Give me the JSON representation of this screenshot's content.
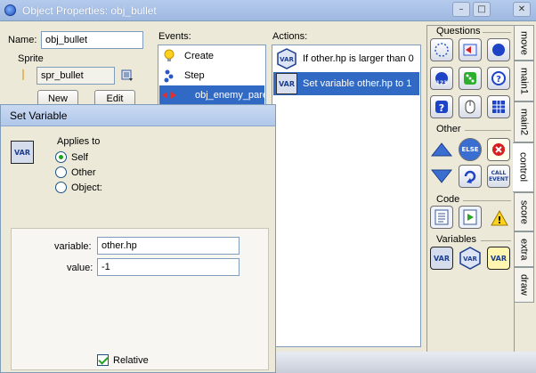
{
  "window": {
    "title": "Object Properties: obj_bullet",
    "minimize_label": "–",
    "maximize_label": "□",
    "close_label": "✕"
  },
  "object": {
    "name_label": "Name:",
    "name_value": "obj_bullet",
    "sprite_label": "Sprite",
    "sprite_value": "spr_bullet",
    "new_label": "New",
    "edit_label": "Edit"
  },
  "events": {
    "header": "Events:",
    "items": [
      {
        "label": "Create",
        "icon": "lightbulb-icon"
      },
      {
        "label": "Step",
        "icon": "step-icon"
      },
      {
        "label": "obj_enemy_pare",
        "icon": "collision-icon"
      }
    ]
  },
  "actions": {
    "header": "Actions:",
    "items": [
      {
        "label": "If other.hp is larger than 0",
        "icon": "var-test-icon"
      },
      {
        "label": "Set variable other.hp to 1",
        "icon": "var-set-icon"
      }
    ]
  },
  "library": {
    "groups": {
      "questions": "Questions",
      "other": "Other",
      "code": "Code",
      "variables": "Variables"
    },
    "tabs": [
      "move",
      "main1",
      "main2",
      "control",
      "score",
      "extra",
      "draw"
    ],
    "active_tab": "control",
    "tile_text": {
      "else": "ELSE",
      "call_event": "CALL EVENT",
      "var": "VAR",
      "dice": "123"
    }
  },
  "dialog": {
    "title": "Set Variable",
    "applies_to_label": "Applies to",
    "options": [
      "Self",
      "Other",
      "Object:"
    ],
    "selected_option": "Self",
    "variable_label": "variable:",
    "variable_value": "other.hp",
    "value_label": "value:",
    "value_value": "-1",
    "relative_label": "Relative",
    "relative_checked": true,
    "icon_text": "VAR"
  },
  "colors": {
    "selection": "#316ac5",
    "titlebar": "#b4cbed"
  }
}
